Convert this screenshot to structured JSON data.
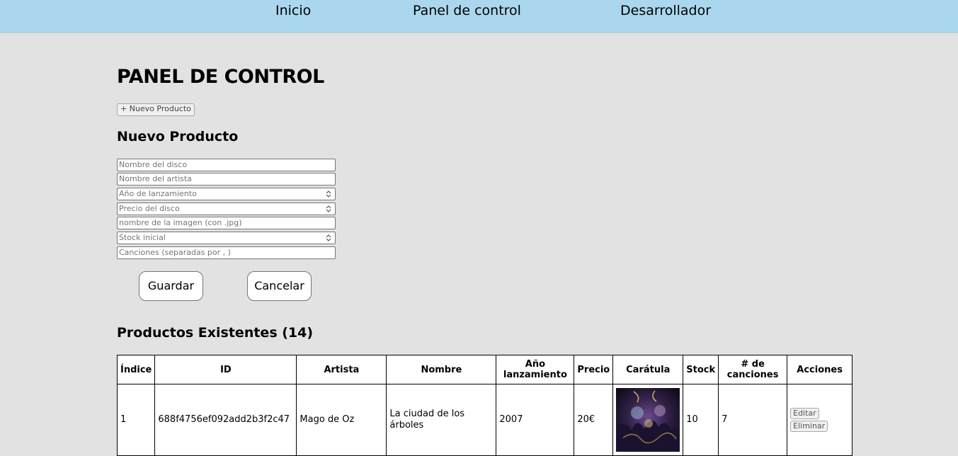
{
  "nav": {
    "inicio": "Inicio",
    "panel": "Panel de control",
    "dev": "Desarrollador"
  },
  "page": {
    "title": "PANEL DE CONTROL",
    "new_product_button": "+ Nuevo Producto"
  },
  "form": {
    "title": "Nuevo Producto",
    "fields": [
      {
        "placeholder": "Nombre del disco",
        "type": "text",
        "value": ""
      },
      {
        "placeholder": "Nombre del artista",
        "type": "text",
        "value": ""
      },
      {
        "placeholder": "Año de lanzamiento",
        "type": "number",
        "value": ""
      },
      {
        "placeholder": "Precio del disco",
        "type": "number",
        "value": ""
      },
      {
        "placeholder": "nombre de la imagen (con .jpg)",
        "type": "text",
        "value": ""
      },
      {
        "placeholder": "Stock inicial",
        "type": "number",
        "value": ""
      },
      {
        "placeholder": "Canciones (separadas por , )",
        "type": "text",
        "value": ""
      }
    ],
    "save_label": "Guardar",
    "cancel_label": "Cancelar"
  },
  "products": {
    "title": "Productos Existentes (14)",
    "headers": {
      "index": "Índice",
      "id": "ID",
      "artist": "Artista",
      "name": "Nombre",
      "year_1": "Año",
      "year_2": "lanzamiento",
      "price": "Precio",
      "cover": "Carátula",
      "stock": "Stock",
      "songs_1": "# de",
      "songs_2": "canciones",
      "actions": "Acciones"
    },
    "rows": [
      {
        "index": "1",
        "id": "688f4756ef092add2b3f2c47",
        "artist": "Mago de Oz",
        "name": "La ciudad de los árboles",
        "year": "2007",
        "price": "20€",
        "stock": "10",
        "songs": "7",
        "edit_label": "Editar",
        "delete_label": "Eliminar"
      }
    ]
  },
  "colors": {
    "nav_bg": "#aad7ee",
    "page_bg": "#e2e2e2",
    "table_bg": "#ffffff"
  },
  "icons": {
    "spinner": "number-spinner-icon",
    "cover": "album-cover-image"
  }
}
